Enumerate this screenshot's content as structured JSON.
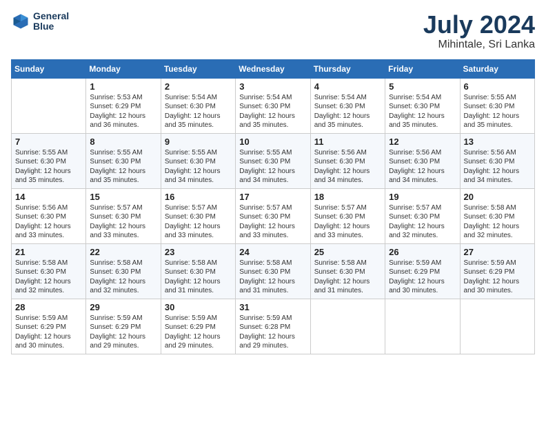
{
  "header": {
    "logo_line1": "General",
    "logo_line2": "Blue",
    "month_year": "July 2024",
    "location": "Mihintale, Sri Lanka"
  },
  "days_of_week": [
    "Sunday",
    "Monday",
    "Tuesday",
    "Wednesday",
    "Thursday",
    "Friday",
    "Saturday"
  ],
  "weeks": [
    [
      {
        "num": "",
        "sunrise": "",
        "sunset": "",
        "daylight": ""
      },
      {
        "num": "1",
        "sunrise": "Sunrise: 5:53 AM",
        "sunset": "Sunset: 6:29 PM",
        "daylight": "Daylight: 12 hours and 36 minutes."
      },
      {
        "num": "2",
        "sunrise": "Sunrise: 5:54 AM",
        "sunset": "Sunset: 6:30 PM",
        "daylight": "Daylight: 12 hours and 35 minutes."
      },
      {
        "num": "3",
        "sunrise": "Sunrise: 5:54 AM",
        "sunset": "Sunset: 6:30 PM",
        "daylight": "Daylight: 12 hours and 35 minutes."
      },
      {
        "num": "4",
        "sunrise": "Sunrise: 5:54 AM",
        "sunset": "Sunset: 6:30 PM",
        "daylight": "Daylight: 12 hours and 35 minutes."
      },
      {
        "num": "5",
        "sunrise": "Sunrise: 5:54 AM",
        "sunset": "Sunset: 6:30 PM",
        "daylight": "Daylight: 12 hours and 35 minutes."
      },
      {
        "num": "6",
        "sunrise": "Sunrise: 5:55 AM",
        "sunset": "Sunset: 6:30 PM",
        "daylight": "Daylight: 12 hours and 35 minutes."
      }
    ],
    [
      {
        "num": "7",
        "sunrise": "Sunrise: 5:55 AM",
        "sunset": "Sunset: 6:30 PM",
        "daylight": "Daylight: 12 hours and 35 minutes."
      },
      {
        "num": "8",
        "sunrise": "Sunrise: 5:55 AM",
        "sunset": "Sunset: 6:30 PM",
        "daylight": "Daylight: 12 hours and 35 minutes."
      },
      {
        "num": "9",
        "sunrise": "Sunrise: 5:55 AM",
        "sunset": "Sunset: 6:30 PM",
        "daylight": "Daylight: 12 hours and 34 minutes."
      },
      {
        "num": "10",
        "sunrise": "Sunrise: 5:55 AM",
        "sunset": "Sunset: 6:30 PM",
        "daylight": "Daylight: 12 hours and 34 minutes."
      },
      {
        "num": "11",
        "sunrise": "Sunrise: 5:56 AM",
        "sunset": "Sunset: 6:30 PM",
        "daylight": "Daylight: 12 hours and 34 minutes."
      },
      {
        "num": "12",
        "sunrise": "Sunrise: 5:56 AM",
        "sunset": "Sunset: 6:30 PM",
        "daylight": "Daylight: 12 hours and 34 minutes."
      },
      {
        "num": "13",
        "sunrise": "Sunrise: 5:56 AM",
        "sunset": "Sunset: 6:30 PM",
        "daylight": "Daylight: 12 hours and 34 minutes."
      }
    ],
    [
      {
        "num": "14",
        "sunrise": "Sunrise: 5:56 AM",
        "sunset": "Sunset: 6:30 PM",
        "daylight": "Daylight: 12 hours and 33 minutes."
      },
      {
        "num": "15",
        "sunrise": "Sunrise: 5:57 AM",
        "sunset": "Sunset: 6:30 PM",
        "daylight": "Daylight: 12 hours and 33 minutes."
      },
      {
        "num": "16",
        "sunrise": "Sunrise: 5:57 AM",
        "sunset": "Sunset: 6:30 PM",
        "daylight": "Daylight: 12 hours and 33 minutes."
      },
      {
        "num": "17",
        "sunrise": "Sunrise: 5:57 AM",
        "sunset": "Sunset: 6:30 PM",
        "daylight": "Daylight: 12 hours and 33 minutes."
      },
      {
        "num": "18",
        "sunrise": "Sunrise: 5:57 AM",
        "sunset": "Sunset: 6:30 PM",
        "daylight": "Daylight: 12 hours and 33 minutes."
      },
      {
        "num": "19",
        "sunrise": "Sunrise: 5:57 AM",
        "sunset": "Sunset: 6:30 PM",
        "daylight": "Daylight: 12 hours and 32 minutes."
      },
      {
        "num": "20",
        "sunrise": "Sunrise: 5:58 AM",
        "sunset": "Sunset: 6:30 PM",
        "daylight": "Daylight: 12 hours and 32 minutes."
      }
    ],
    [
      {
        "num": "21",
        "sunrise": "Sunrise: 5:58 AM",
        "sunset": "Sunset: 6:30 PM",
        "daylight": "Daylight: 12 hours and 32 minutes."
      },
      {
        "num": "22",
        "sunrise": "Sunrise: 5:58 AM",
        "sunset": "Sunset: 6:30 PM",
        "daylight": "Daylight: 12 hours and 32 minutes."
      },
      {
        "num": "23",
        "sunrise": "Sunrise: 5:58 AM",
        "sunset": "Sunset: 6:30 PM",
        "daylight": "Daylight: 12 hours and 31 minutes."
      },
      {
        "num": "24",
        "sunrise": "Sunrise: 5:58 AM",
        "sunset": "Sunset: 6:30 PM",
        "daylight": "Daylight: 12 hours and 31 minutes."
      },
      {
        "num": "25",
        "sunrise": "Sunrise: 5:58 AM",
        "sunset": "Sunset: 6:30 PM",
        "daylight": "Daylight: 12 hours and 31 minutes."
      },
      {
        "num": "26",
        "sunrise": "Sunrise: 5:59 AM",
        "sunset": "Sunset: 6:29 PM",
        "daylight": "Daylight: 12 hours and 30 minutes."
      },
      {
        "num": "27",
        "sunrise": "Sunrise: 5:59 AM",
        "sunset": "Sunset: 6:29 PM",
        "daylight": "Daylight: 12 hours and 30 minutes."
      }
    ],
    [
      {
        "num": "28",
        "sunrise": "Sunrise: 5:59 AM",
        "sunset": "Sunset: 6:29 PM",
        "daylight": "Daylight: 12 hours and 30 minutes."
      },
      {
        "num": "29",
        "sunrise": "Sunrise: 5:59 AM",
        "sunset": "Sunset: 6:29 PM",
        "daylight": "Daylight: 12 hours and 29 minutes."
      },
      {
        "num": "30",
        "sunrise": "Sunrise: 5:59 AM",
        "sunset": "Sunset: 6:29 PM",
        "daylight": "Daylight: 12 hours and 29 minutes."
      },
      {
        "num": "31",
        "sunrise": "Sunrise: 5:59 AM",
        "sunset": "Sunset: 6:28 PM",
        "daylight": "Daylight: 12 hours and 29 minutes."
      },
      {
        "num": "",
        "sunrise": "",
        "sunset": "",
        "daylight": ""
      },
      {
        "num": "",
        "sunrise": "",
        "sunset": "",
        "daylight": ""
      },
      {
        "num": "",
        "sunrise": "",
        "sunset": "",
        "daylight": ""
      }
    ]
  ]
}
